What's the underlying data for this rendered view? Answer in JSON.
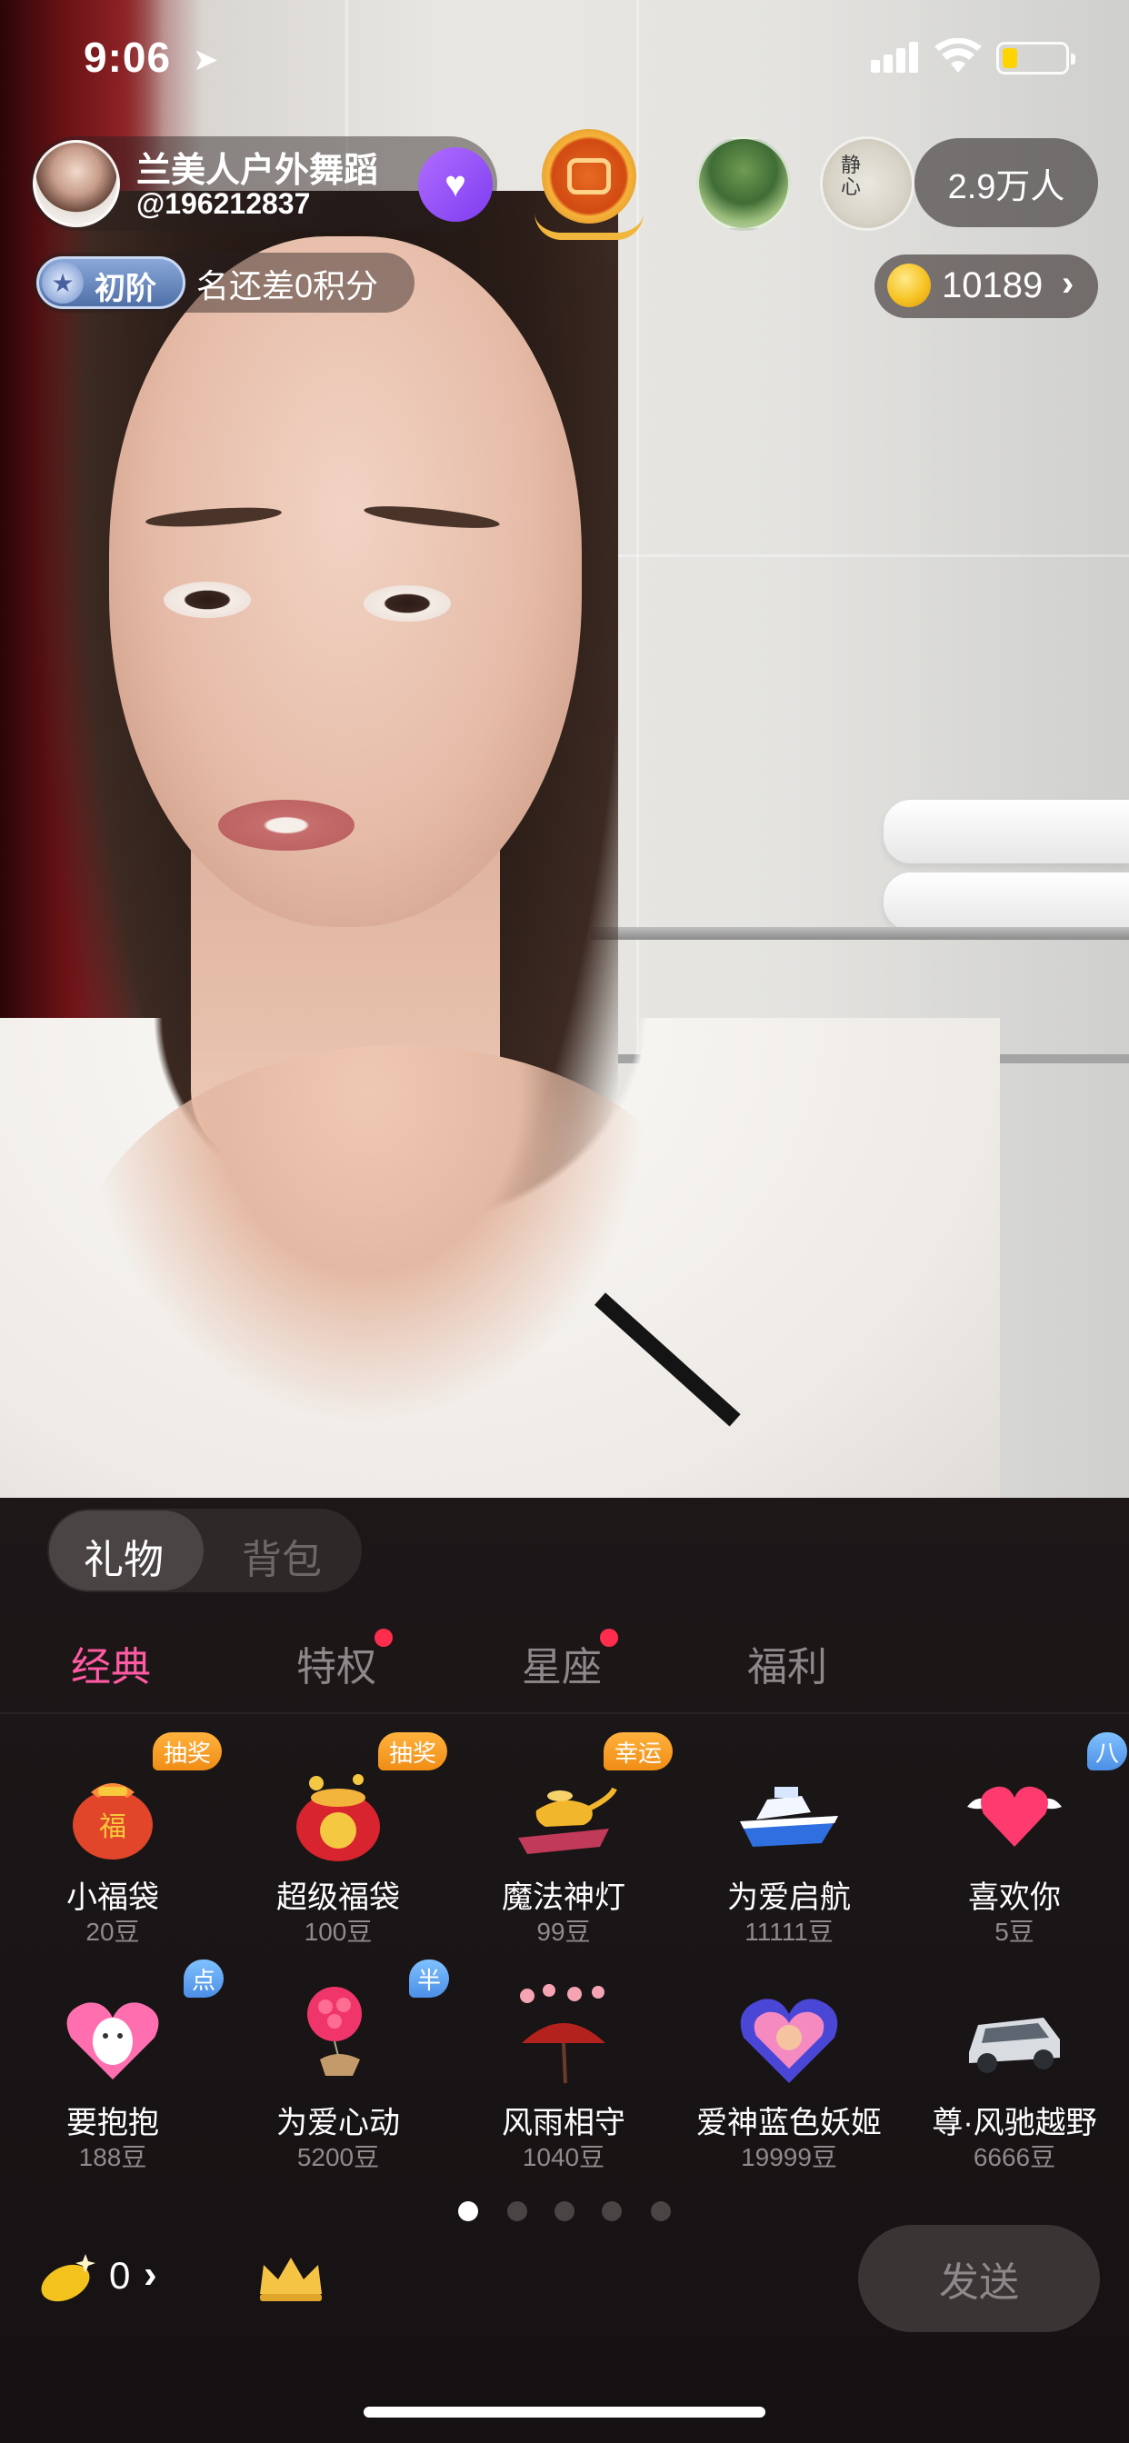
{
  "status_bar": {
    "time": "9:06"
  },
  "host": {
    "name": "兰美人户外舞蹈",
    "id": "@196212837",
    "rank_level": "初阶",
    "rank_desc": "名还差0积分"
  },
  "viewers": {
    "count": "2.9万人"
  },
  "coins": {
    "balance": "10189"
  },
  "gift_panel": {
    "tabs": [
      "礼物",
      "背包"
    ],
    "categories": [
      "经典",
      "特权",
      "星座",
      "福利"
    ],
    "active_category": "经典",
    "gifts": [
      {
        "name": "小福袋",
        "price": "20豆",
        "tag": "抽奖"
      },
      {
        "name": "超级福袋",
        "price": "100豆",
        "tag": "抽奖"
      },
      {
        "name": "魔法神灯",
        "price": "99豆",
        "tag": "幸运"
      },
      {
        "name": "为爱启航",
        "price": "11111豆",
        "tag": ""
      },
      {
        "name": "喜欢你",
        "price": "5豆",
        "tag": "八"
      },
      {
        "name": "要抱抱",
        "price": "188豆",
        "tag": "点"
      },
      {
        "name": "为爱心动",
        "price": "5200豆",
        "tag": "半"
      },
      {
        "name": "风雨相守",
        "price": "1040豆",
        "tag": ""
      },
      {
        "name": "爱神蓝色妖姬",
        "price": "19999豆",
        "tag": ""
      },
      {
        "name": "尊·风驰越野",
        "price": "6666豆",
        "tag": ""
      }
    ],
    "page_count": 5,
    "current_page": 1,
    "bean_count": "0",
    "send_label": "发送"
  },
  "colors": {
    "accent": "#ff5aa3",
    "coin": "#f6c323",
    "tag_orange": "#f08d16",
    "tag_blue": "#4c8fe6"
  }
}
